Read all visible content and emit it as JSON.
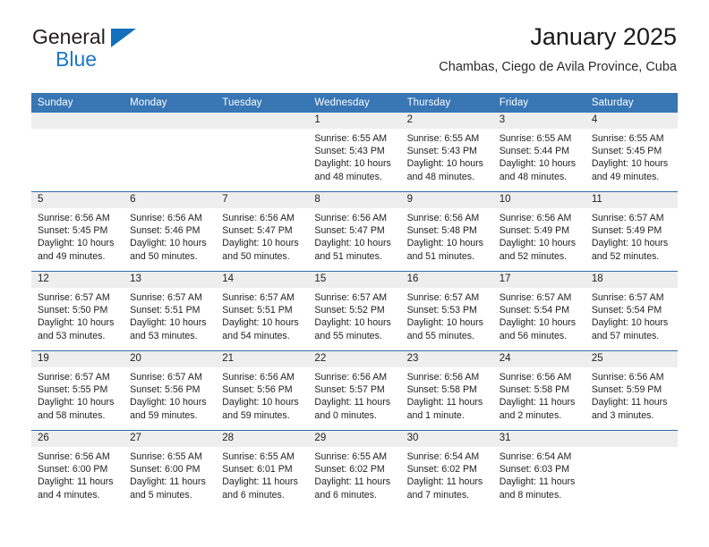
{
  "brand": {
    "name_part1": "General",
    "name_part2": "Blue",
    "accent_color": "#1b76c7",
    "triangle_icon": "triangle-right-icon"
  },
  "header": {
    "title": "January 2025",
    "subtitle": "Chambas, Ciego de Avila Province, Cuba"
  },
  "calendar": {
    "header_bg": "#3876b4",
    "row_divider_color": "#2f6ca8",
    "daynum_strip_bg": "#eeeeee",
    "weekday_headers": [
      "Sunday",
      "Monday",
      "Tuesday",
      "Wednesday",
      "Thursday",
      "Friday",
      "Saturday"
    ],
    "weeks": [
      [
        {
          "day": "",
          "lines": []
        },
        {
          "day": "",
          "lines": []
        },
        {
          "day": "",
          "lines": []
        },
        {
          "day": "1",
          "lines": [
            "Sunrise: 6:55 AM",
            "Sunset: 5:43 PM",
            "Daylight: 10 hours",
            "and 48 minutes."
          ]
        },
        {
          "day": "2",
          "lines": [
            "Sunrise: 6:55 AM",
            "Sunset: 5:43 PM",
            "Daylight: 10 hours",
            "and 48 minutes."
          ]
        },
        {
          "day": "3",
          "lines": [
            "Sunrise: 6:55 AM",
            "Sunset: 5:44 PM",
            "Daylight: 10 hours",
            "and 48 minutes."
          ]
        },
        {
          "day": "4",
          "lines": [
            "Sunrise: 6:55 AM",
            "Sunset: 5:45 PM",
            "Daylight: 10 hours",
            "and 49 minutes."
          ]
        }
      ],
      [
        {
          "day": "5",
          "lines": [
            "Sunrise: 6:56 AM",
            "Sunset: 5:45 PM",
            "Daylight: 10 hours",
            "and 49 minutes."
          ]
        },
        {
          "day": "6",
          "lines": [
            "Sunrise: 6:56 AM",
            "Sunset: 5:46 PM",
            "Daylight: 10 hours",
            "and 50 minutes."
          ]
        },
        {
          "day": "7",
          "lines": [
            "Sunrise: 6:56 AM",
            "Sunset: 5:47 PM",
            "Daylight: 10 hours",
            "and 50 minutes."
          ]
        },
        {
          "day": "8",
          "lines": [
            "Sunrise: 6:56 AM",
            "Sunset: 5:47 PM",
            "Daylight: 10 hours",
            "and 51 minutes."
          ]
        },
        {
          "day": "9",
          "lines": [
            "Sunrise: 6:56 AM",
            "Sunset: 5:48 PM",
            "Daylight: 10 hours",
            "and 51 minutes."
          ]
        },
        {
          "day": "10",
          "lines": [
            "Sunrise: 6:56 AM",
            "Sunset: 5:49 PM",
            "Daylight: 10 hours",
            "and 52 minutes."
          ]
        },
        {
          "day": "11",
          "lines": [
            "Sunrise: 6:57 AM",
            "Sunset: 5:49 PM",
            "Daylight: 10 hours",
            "and 52 minutes."
          ]
        }
      ],
      [
        {
          "day": "12",
          "lines": [
            "Sunrise: 6:57 AM",
            "Sunset: 5:50 PM",
            "Daylight: 10 hours",
            "and 53 minutes."
          ]
        },
        {
          "day": "13",
          "lines": [
            "Sunrise: 6:57 AM",
            "Sunset: 5:51 PM",
            "Daylight: 10 hours",
            "and 53 minutes."
          ]
        },
        {
          "day": "14",
          "lines": [
            "Sunrise: 6:57 AM",
            "Sunset: 5:51 PM",
            "Daylight: 10 hours",
            "and 54 minutes."
          ]
        },
        {
          "day": "15",
          "lines": [
            "Sunrise: 6:57 AM",
            "Sunset: 5:52 PM",
            "Daylight: 10 hours",
            "and 55 minutes."
          ]
        },
        {
          "day": "16",
          "lines": [
            "Sunrise: 6:57 AM",
            "Sunset: 5:53 PM",
            "Daylight: 10 hours",
            "and 55 minutes."
          ]
        },
        {
          "day": "17",
          "lines": [
            "Sunrise: 6:57 AM",
            "Sunset: 5:54 PM",
            "Daylight: 10 hours",
            "and 56 minutes."
          ]
        },
        {
          "day": "18",
          "lines": [
            "Sunrise: 6:57 AM",
            "Sunset: 5:54 PM",
            "Daylight: 10 hours",
            "and 57 minutes."
          ]
        }
      ],
      [
        {
          "day": "19",
          "lines": [
            "Sunrise: 6:57 AM",
            "Sunset: 5:55 PM",
            "Daylight: 10 hours",
            "and 58 minutes."
          ]
        },
        {
          "day": "20",
          "lines": [
            "Sunrise: 6:57 AM",
            "Sunset: 5:56 PM",
            "Daylight: 10 hours",
            "and 59 minutes."
          ]
        },
        {
          "day": "21",
          "lines": [
            "Sunrise: 6:56 AM",
            "Sunset: 5:56 PM",
            "Daylight: 10 hours",
            "and 59 minutes."
          ]
        },
        {
          "day": "22",
          "lines": [
            "Sunrise: 6:56 AM",
            "Sunset: 5:57 PM",
            "Daylight: 11 hours",
            "and 0 minutes."
          ]
        },
        {
          "day": "23",
          "lines": [
            "Sunrise: 6:56 AM",
            "Sunset: 5:58 PM",
            "Daylight: 11 hours",
            "and 1 minute."
          ]
        },
        {
          "day": "24",
          "lines": [
            "Sunrise: 6:56 AM",
            "Sunset: 5:58 PM",
            "Daylight: 11 hours",
            "and 2 minutes."
          ]
        },
        {
          "day": "25",
          "lines": [
            "Sunrise: 6:56 AM",
            "Sunset: 5:59 PM",
            "Daylight: 11 hours",
            "and 3 minutes."
          ]
        }
      ],
      [
        {
          "day": "26",
          "lines": [
            "Sunrise: 6:56 AM",
            "Sunset: 6:00 PM",
            "Daylight: 11 hours",
            "and 4 minutes."
          ]
        },
        {
          "day": "27",
          "lines": [
            "Sunrise: 6:55 AM",
            "Sunset: 6:00 PM",
            "Daylight: 11 hours",
            "and 5 minutes."
          ]
        },
        {
          "day": "28",
          "lines": [
            "Sunrise: 6:55 AM",
            "Sunset: 6:01 PM",
            "Daylight: 11 hours",
            "and 6 minutes."
          ]
        },
        {
          "day": "29",
          "lines": [
            "Sunrise: 6:55 AM",
            "Sunset: 6:02 PM",
            "Daylight: 11 hours",
            "and 6 minutes."
          ]
        },
        {
          "day": "30",
          "lines": [
            "Sunrise: 6:54 AM",
            "Sunset: 6:02 PM",
            "Daylight: 11 hours",
            "and 7 minutes."
          ]
        },
        {
          "day": "31",
          "lines": [
            "Sunrise: 6:54 AM",
            "Sunset: 6:03 PM",
            "Daylight: 11 hours",
            "and 8 minutes."
          ]
        },
        {
          "day": "",
          "lines": []
        }
      ]
    ]
  }
}
